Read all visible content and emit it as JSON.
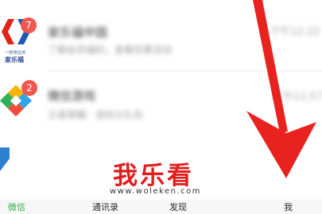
{
  "chats": [
    {
      "name": "家乐福中国",
      "preview": "了解会员福利，查看优惠活动",
      "time": "下午12:22",
      "badge": "7",
      "avatar_icon": "carrefour-logo",
      "avatar_slogan": "一样地位的",
      "avatar_name": "家乐福"
    },
    {
      "name": "微信游戏",
      "preview": "王者荣耀：送你大礼包",
      "time": "上午11:57",
      "badge": "2",
      "avatar_icon": "wechat-games-logo"
    }
  ],
  "tabs": [
    {
      "label": "微信",
      "active": true
    },
    {
      "label": "通讯录",
      "active": false
    },
    {
      "label": "发现",
      "active": false
    },
    {
      "label": "我",
      "active": false
    }
  ],
  "watermark": {
    "title": "我乐看",
    "url": "www.woleken.com"
  },
  "colors": {
    "badge": "#f0574e",
    "arrow": "#e8231f",
    "active_tab": "#35b04a",
    "watermark_title": "#e11d1d"
  }
}
